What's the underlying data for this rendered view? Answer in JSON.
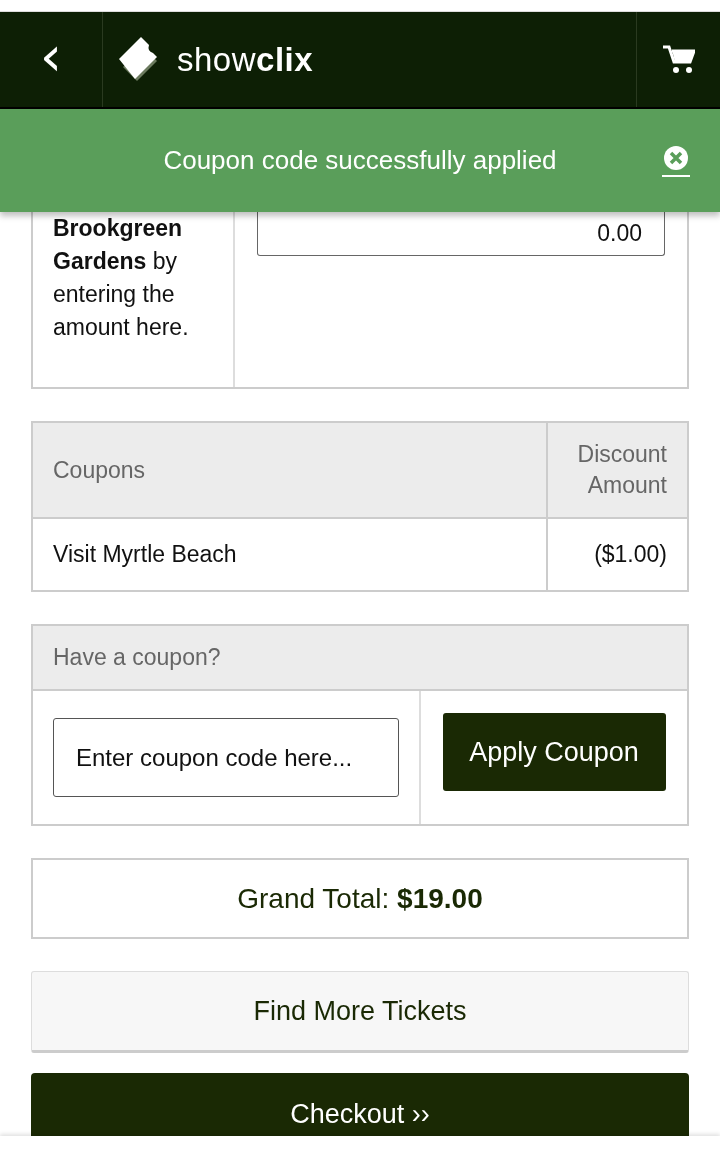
{
  "header": {
    "back": "‹",
    "logo": {
      "part_1": "show",
      "part_2": "clix"
    }
  },
  "toast": {
    "message": "Coupon code successfully applied"
  },
  "donation": {
    "text": "**Brookgreen Gardens** by entering the amount here.",
    "amount": "0.00"
  },
  "coupons_table": {
    "columns": [
      "Coupons",
      "Discount Amount"
    ],
    "rows": [
      {
        "name": "Visit Myrtle Beach",
        "amount": "($1.00)"
      }
    ]
  },
  "coupon_form": {
    "title": "Have a coupon?",
    "placeholder": "Enter coupon code here...",
    "button": "Apply Coupon"
  },
  "grand_total": {
    "label": "Grand Total:",
    "value": "$19.00"
  },
  "buttons": {
    "find_more": "Find More Tickets",
    "checkout": "Checkout ››"
  }
}
